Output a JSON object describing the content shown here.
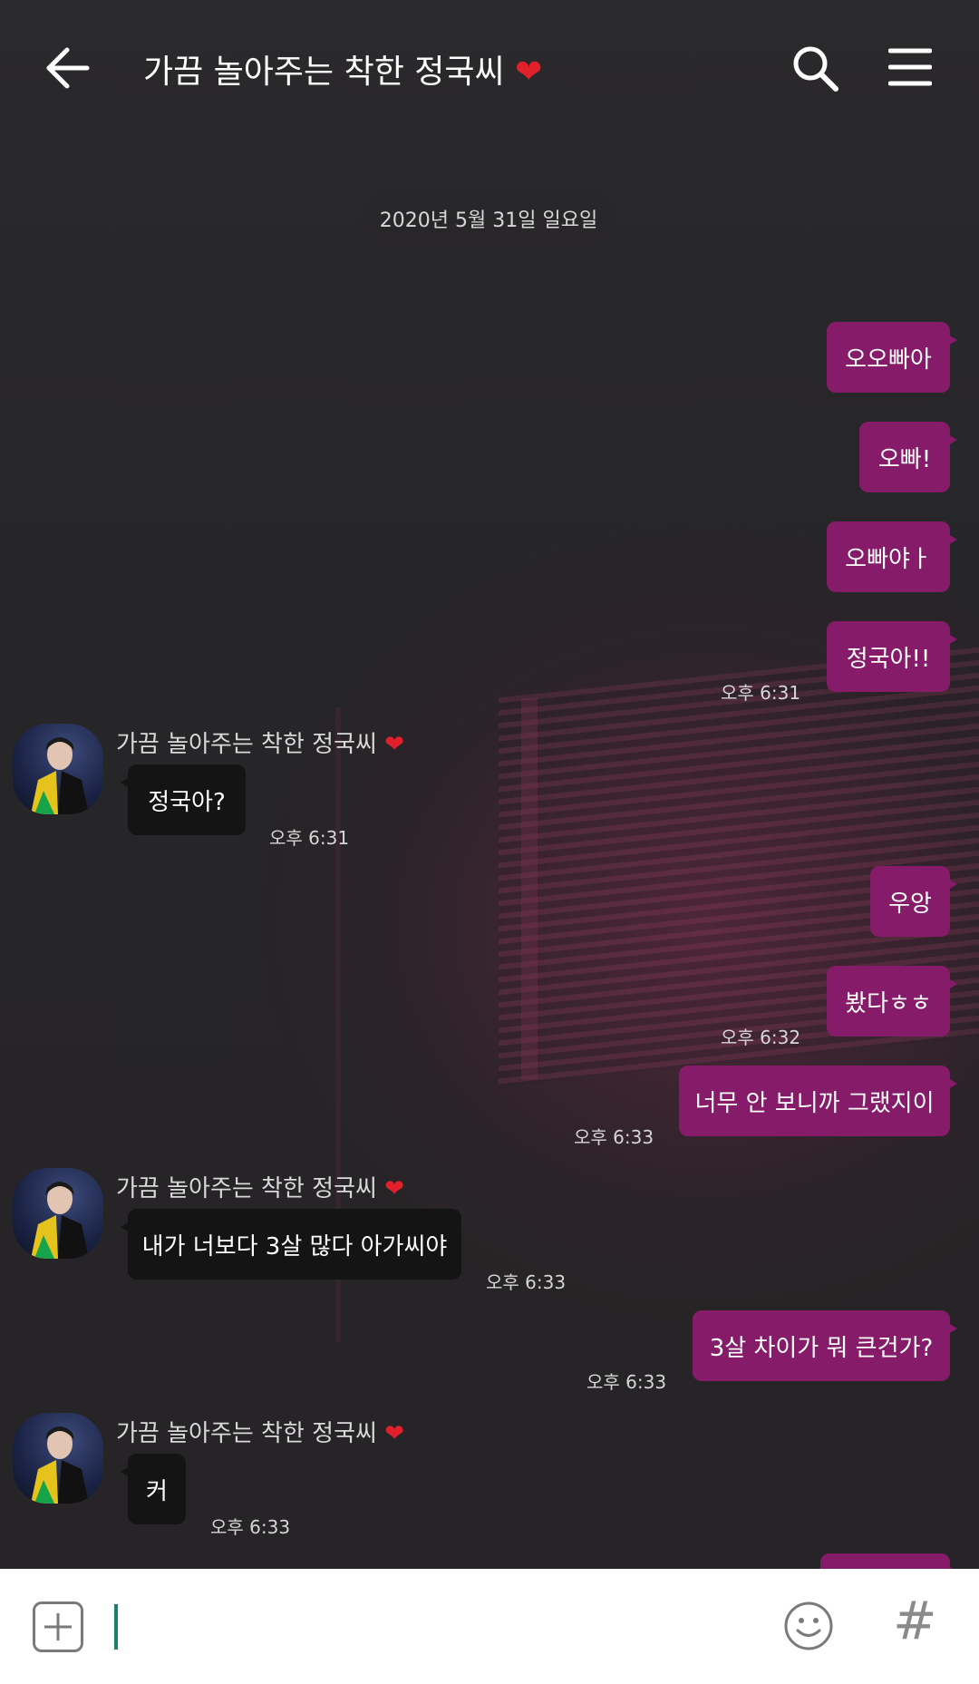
{
  "header": {
    "title": "가끔 놀아주는 착한 정국씨",
    "title_heart": "❤",
    "back_icon": "arrow-left-icon",
    "search_icon": "search-icon",
    "menu_icon": "hamburger-menu-icon"
  },
  "date_divider": "2020년 5월 31일 일요일",
  "sender_name": "가끔 놀아주는 착한 정국씨",
  "sender_heart": "❤",
  "messages": {
    "m1": "오오빠아",
    "m2": "오빠!",
    "m3": "오빠야ㅏ",
    "m4": "정국아!!",
    "t4": "오후 6:31",
    "r1": "정국아?",
    "rt1": "오후 6:31",
    "m5": "우앙",
    "m6": "봤다ㅎㅎ",
    "t6": "오후 6:32",
    "m7": "너무 안 보니까 그랬지이",
    "t7": "오후 6:33",
    "r2": "내가 너보다 3살 많다 아가씨야",
    "rt2": "오후 6:33",
    "m8": "3살 차이가 뭐 큰건가?",
    "t8": "오후 6:33",
    "r3": "커",
    "rt3": "오후 6:33"
  },
  "input": {
    "placeholder": "",
    "value": "",
    "add_icon": "plus-square-icon",
    "emoji_icon": "smiley-icon",
    "hash_symbol": "#"
  },
  "colors": {
    "my_bubble": "#861b69",
    "their_bubble": "#141414",
    "background": "#262527",
    "cursor": "#1b7f6e"
  }
}
